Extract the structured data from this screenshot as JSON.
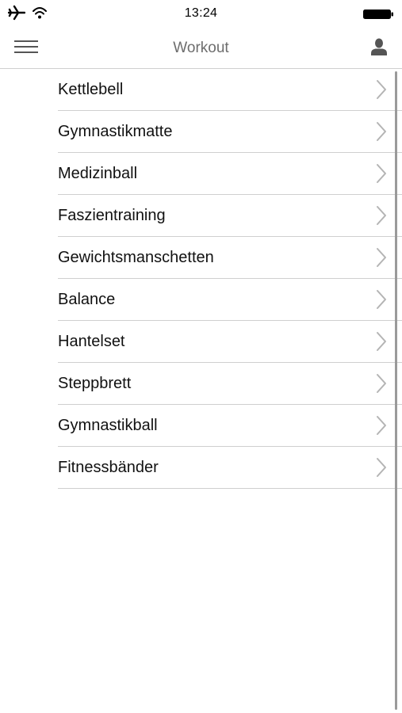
{
  "status_bar": {
    "time": "13:24",
    "left_icons": [
      "airplane-icon",
      "wifi-icon"
    ],
    "right_icons": [
      "battery-icon"
    ]
  },
  "nav": {
    "title": "Workout",
    "left_icon": "hamburger-menu-icon",
    "right_icon": "user-profile-icon"
  },
  "list": {
    "items": [
      {
        "label": "Kettlebell"
      },
      {
        "label": "Gymnastikmatte"
      },
      {
        "label": "Medizinball"
      },
      {
        "label": "Faszientraining"
      },
      {
        "label": "Gewichtsmanschetten"
      },
      {
        "label": "Balance"
      },
      {
        "label": "Hantelset"
      },
      {
        "label": "Steppbrett"
      },
      {
        "label": "Gymnastikball"
      },
      {
        "label": "Fitnessbänder"
      }
    ],
    "disclosure_icon": "chevron-right-icon"
  },
  "colors": {
    "title": "#6d6d6d",
    "separator": "#cfcfcf",
    "chevron": "#b4b4b4",
    "icon": "#555555",
    "scrollbar": "#9a9a9a"
  }
}
